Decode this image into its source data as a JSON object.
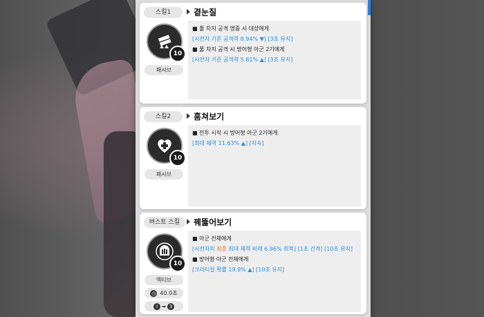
{
  "skills": [
    {
      "tag": "스킬1",
      "name": "곁눈질",
      "level": "10",
      "type": "패시브",
      "icon": "guns-up-arrows-icon",
      "lines": [
        {
          "kind": "head",
          "text": "■ 풀 차지 공격 명중 시 대상에게"
        },
        {
          "kind": "blue",
          "text": "[시전자 기준 공격력 8.94% ▼] [3초 유지]"
        },
        {
          "kind": "head",
          "text": "■ 풀 차지 공격 시 방어형 아군 2기에게"
        },
        {
          "kind": "blue",
          "text": "[시전자 기준 공격력 5.81% ▲] [3초 유지]"
        }
      ]
    },
    {
      "tag": "스킬2",
      "name": "훔쳐보기",
      "level": "10",
      "type": "패시브",
      "icon": "heart-plus-icon",
      "lines": [
        {
          "kind": "head",
          "text": "■ 전투 시작 시 방어형 아군 2기에게"
        },
        {
          "kind": "blue",
          "text": "[최대 체력 11.63% ▲] [지속]"
        }
      ]
    },
    {
      "tag": "버스트 스킬",
      "name": "꿰뚫어보기",
      "level": "10",
      "type": "액티브",
      "icon": "shield-alarm-icon",
      "cooldown": "40.0초",
      "burst_from": "I",
      "burst_to": "3",
      "lines": [
        {
          "kind": "head",
          "text": "■ 아군 전체에게"
        },
        {
          "kind": "mixed",
          "parts": [
            {
              "c": "b",
              "t": "[시전자의 "
            },
            {
              "c": "o",
              "t": "최종"
            },
            {
              "c": "b",
              "t": " 최대 체력 비례 6.96% 회복] [1초 간격] [10초 유지]"
            }
          ]
        },
        {
          "kind": "head",
          "text": "■ 방어형 아군 전체에게"
        },
        {
          "kind": "blue",
          "text": "[크리티컬 확률 19.9% ▲] [10초 유지]"
        }
      ]
    }
  ]
}
